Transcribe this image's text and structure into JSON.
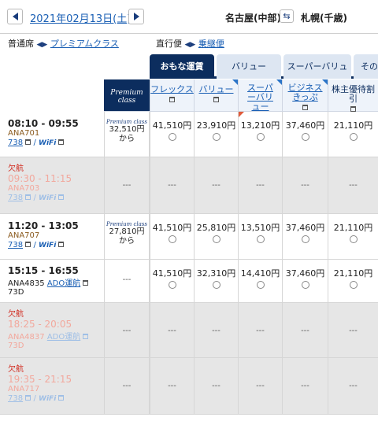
{
  "header": {
    "date": "2021年02月13日(土)",
    "from": "名古屋(中部)",
    "to": "札幌(千歳)"
  },
  "filters": {
    "seat_class": "普通席",
    "premium_link": "プレミアムクラス",
    "direct_label": "直行便",
    "transfer_link": "乗継便"
  },
  "tabs": [
    "おもな運賃",
    "バリュー",
    "スーパーバリュー",
    "その"
  ],
  "fare_headers": [
    "フレックス",
    "バリュー",
    "スーパーバリュー",
    "ビジネスきっぷ",
    "株主優待割引"
  ],
  "premium_header": "Premium class",
  "labels": {
    "cancelled": "欠航",
    "wifi": "WiFi",
    "from_suffix": "から",
    "dash": "---",
    "slash": "/"
  },
  "flights": [
    {
      "time": "08:10 - 09:55",
      "flight": "ANA701",
      "aircraft": "738",
      "cancelled": false,
      "premium_price": "32,510円",
      "prices": [
        "41,510円",
        "23,910円",
        "13,210円",
        "37,460円",
        "21,110円"
      ]
    },
    {
      "time": "09:30 - 11:15",
      "flight": "ANA703",
      "aircraft": "738",
      "cancelled": true
    },
    {
      "time": "11:20 - 13:05",
      "flight": "ANA707",
      "aircraft": "738",
      "cancelled": false,
      "premium_price": "27,810円",
      "prices": [
        "41,510円",
        "25,810円",
        "13,510円",
        "37,460円",
        "21,110円"
      ]
    },
    {
      "time": "15:15 - 16:55",
      "flight": "ANA4835",
      "operator": "ADO運航",
      "aircraft": "73D",
      "cancelled": false,
      "prices": [
        "41,510円",
        "32,310円",
        "14,410円",
        "37,460円",
        "21,110円"
      ]
    },
    {
      "time": "18:25 - 20:05",
      "flight": "ANA4837",
      "operator": "ADO運航",
      "aircraft": "73D",
      "cancelled": true
    },
    {
      "time": "19:35 - 21:15",
      "flight": "ANA717",
      "aircraft": "738",
      "cancelled": true
    }
  ],
  "colors": {
    "navy": "#0c2d5e",
    "link": "#1a5fb4",
    "cancelled": "#d0281c",
    "cancelled_row": "#e6e6e6"
  }
}
